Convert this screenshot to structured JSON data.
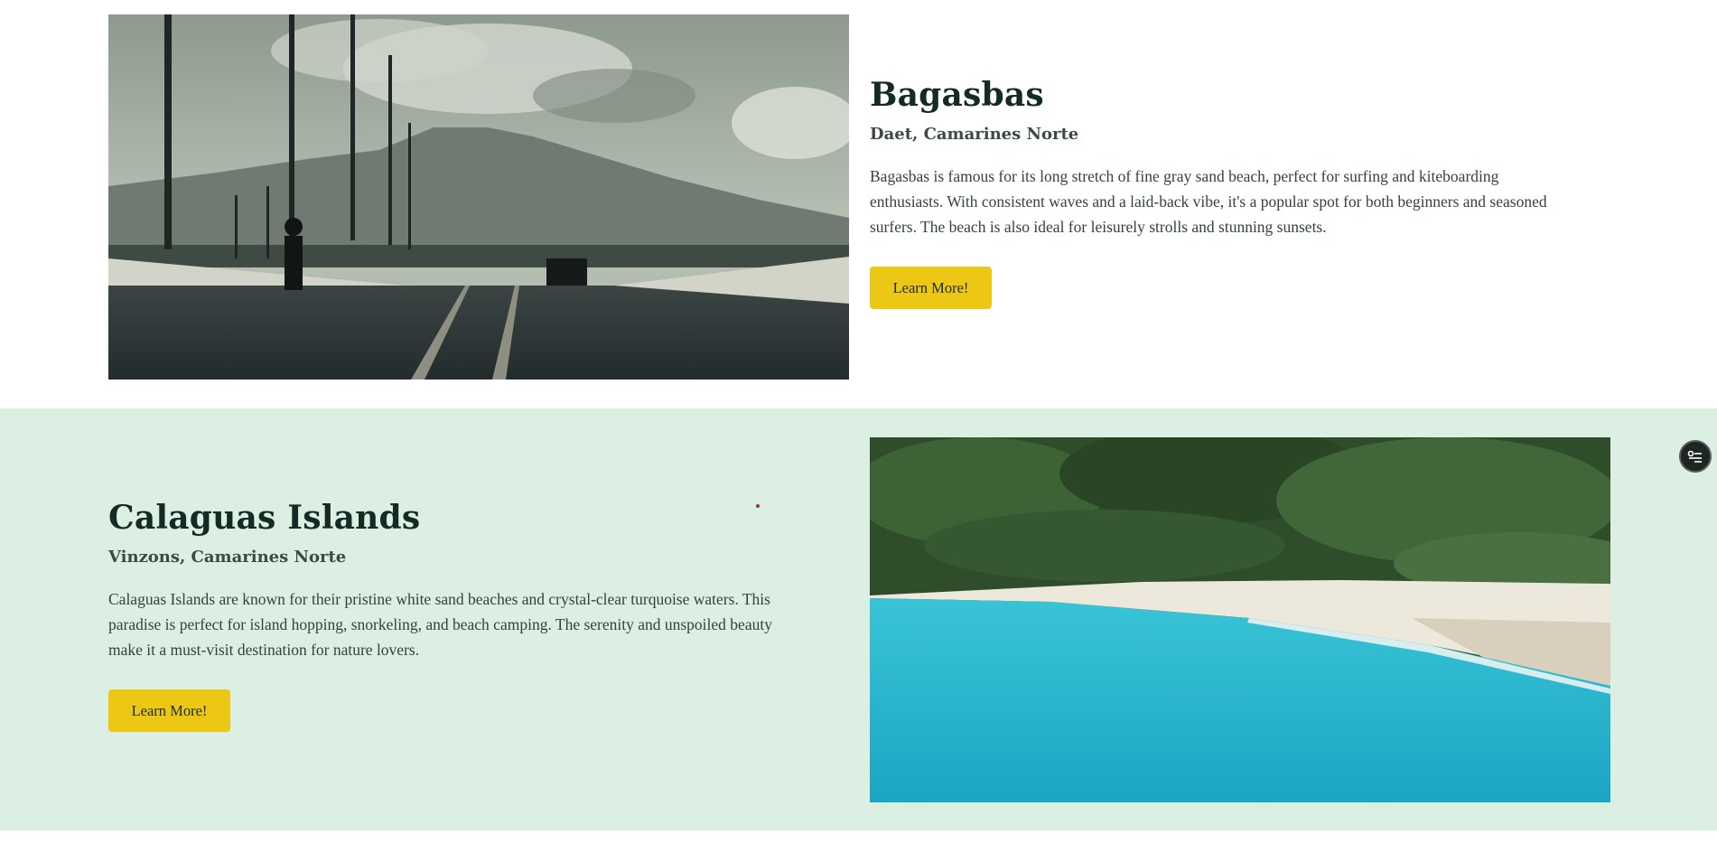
{
  "destinations": [
    {
      "title": "Bagasbas",
      "location": "Daet, Camarines Norte",
      "description_lines": [
        "Bagasbas is famous for its long stretch of fine gray sand beach, perfect for surfing and kiteboarding",
        "enthusiasts. With consistent waves and a laid-back vibe, it's a popular spot for both beginners and seasoned",
        "surfers. The beach is also ideal for leisurely strolls and stunning sunsets."
      ],
      "button_label": "Learn More!",
      "image_icon": "bridge-photo"
    },
    {
      "title": "Calaguas Islands",
      "location": "Vinzons, Camarines Norte",
      "description_lines": [
        "Calaguas Islands are known for their pristine white sand beaches and crystal-clear turquoise waters. This",
        "paradise is perfect for island hopping, snorkeling, and beach camping. The serenity and unspoiled beauty",
        "make it a must-visit destination for nature lovers."
      ],
      "button_label": "Learn More!",
      "image_icon": "beach-photo"
    }
  ],
  "colors": {
    "section_alt_bg": "#dcefe3",
    "button_bg": "#ecc814",
    "title": "#142a24"
  },
  "floating_button_icon": "list-settings-icon"
}
